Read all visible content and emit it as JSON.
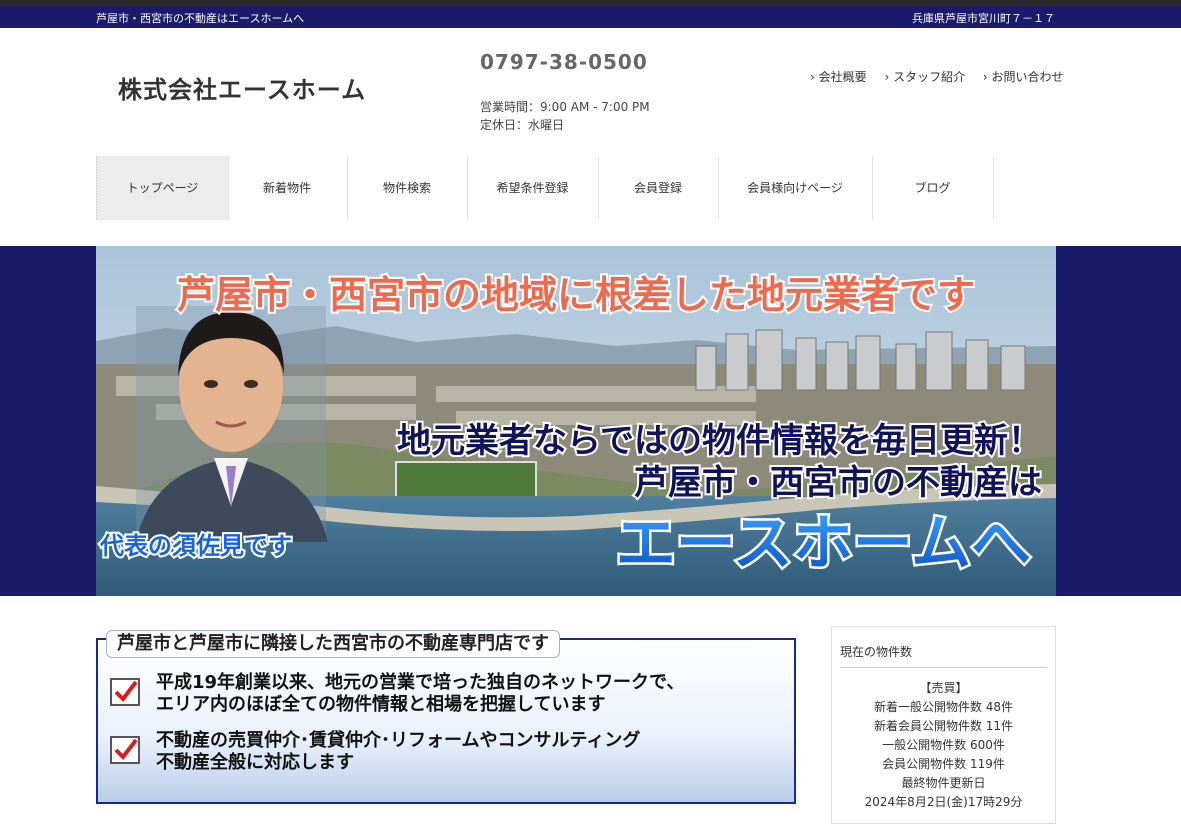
{
  "topbar": {
    "tagline": "芦屋市・西宮市の不動産はエースホームへ",
    "address": "兵庫県芦屋市宮川町７－１７"
  },
  "header": {
    "company": "株式会社エースホーム",
    "phone": "0797-38-0500",
    "hours": "営業時間：9:00 AM - 7:00 PM",
    "closed": "定休日：水曜日",
    "links": [
      "› 会社概要",
      "› スタッフ紹介",
      "› お問い合わせ"
    ]
  },
  "nav": [
    "トップページ",
    "新着物件",
    "物件検索",
    "希望条件登録",
    "会員登録",
    "会員様向けページ",
    "ブログ"
  ],
  "hero": {
    "headline": "芦屋市・西宮市の地域に根差した地元業者です",
    "line1": "地元業者ならではの物件情報を毎日更新！",
    "line2": "芦屋市・西宮市の不動産は",
    "line3": "エースホームへ",
    "caption": "代表の須佐見です"
  },
  "info": {
    "title": "芦屋市と芦屋市に隣接した西宮市の不動産専門店です",
    "points": [
      [
        "平成19年創業以来、地元の営業で培った独自のネットワークで、",
        "エリア内のほぼ全ての物件情報と相場を把握しています"
      ],
      [
        "不動産の売買仲介･賃貸仲介･リフォームやコンサルティング",
        "不動産全般に対応します"
      ]
    ]
  },
  "sidebar": {
    "title": "現在の物件数",
    "section": "【売買】",
    "lines": [
      "新着一般公開物件数 48件",
      "新着会員公開物件数 11件",
      "一般公開物件数 600件",
      "会員公開物件数 119件",
      "最終物件更新日",
      "2024年8月2日(金)17時29分"
    ]
  },
  "colors": {
    "topbar": "#1b1b6b",
    "hero_band": "#1a1a6a",
    "accent_red": "#e0452b",
    "accent_blue": "#1170d8"
  }
}
